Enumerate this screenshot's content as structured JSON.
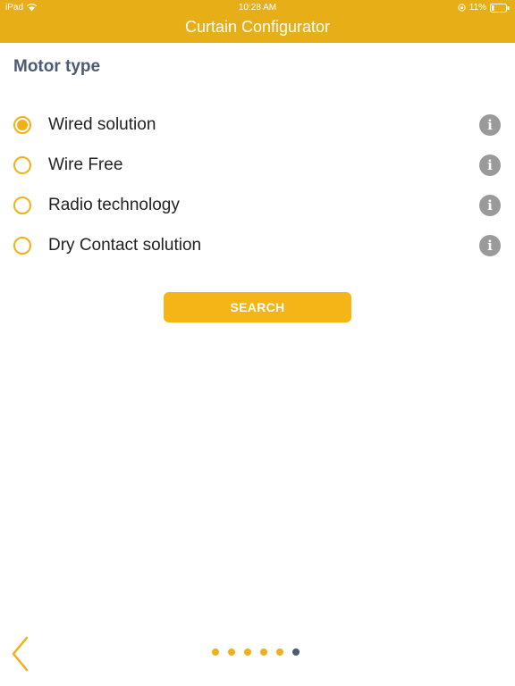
{
  "status_bar": {
    "device": "iPad",
    "time": "10:28 AM",
    "battery": "11%"
  },
  "header": {
    "title": "Curtain Configurator"
  },
  "section_title": "Motor type",
  "options": [
    {
      "label": "Wired solution",
      "selected": true
    },
    {
      "label": "Wire Free",
      "selected": false
    },
    {
      "label": "Radio technology",
      "selected": false
    },
    {
      "label": "Dry Contact solution",
      "selected": false
    }
  ],
  "info_glyph": "i",
  "search_label": "SEARCH",
  "pagination": {
    "total": 6,
    "current": 6
  },
  "colors": {
    "header": "#E8AE17",
    "accent": "#F1B116",
    "button": "#F5B516",
    "title_text": "#4C5B73",
    "info_icon": "#9A9A9A"
  }
}
